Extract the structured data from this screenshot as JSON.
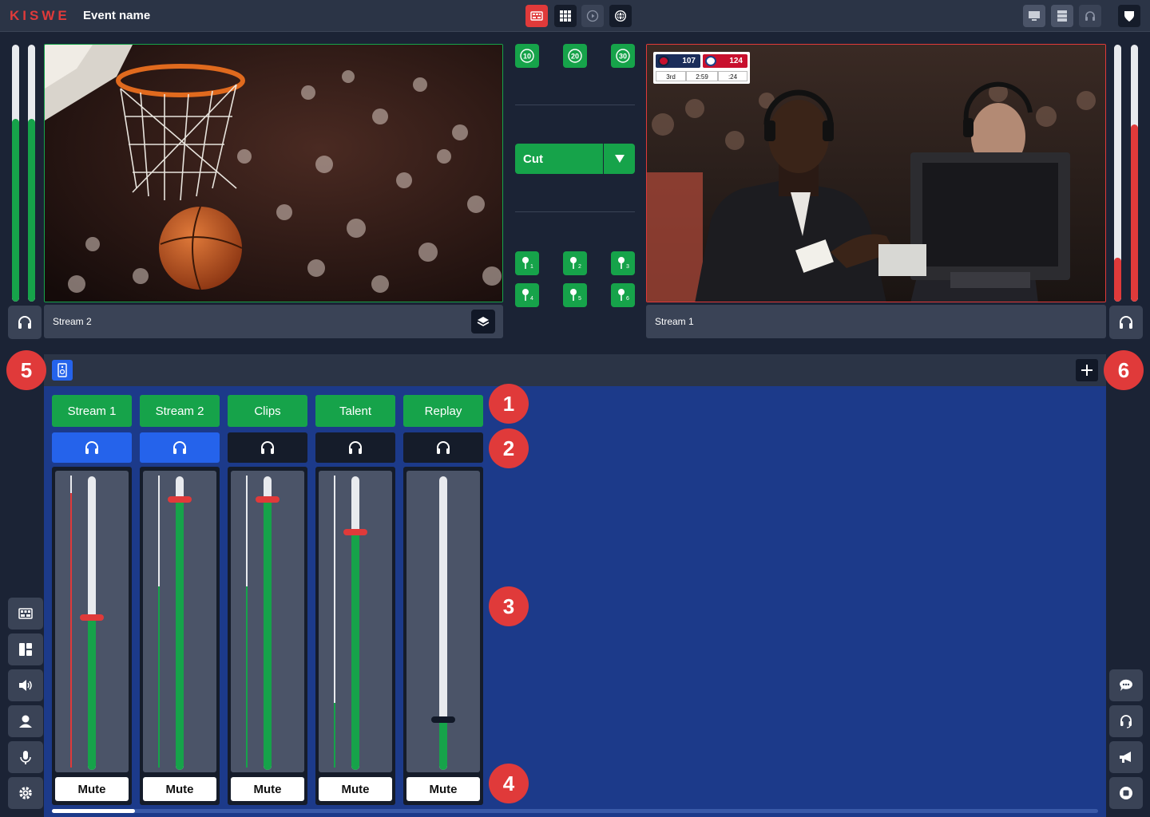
{
  "topbar": {
    "logo": "KISWE",
    "event_name": "Event name",
    "center_buttons": [
      "multiview-icon",
      "grid-icon",
      "replay-icon",
      "web-icon"
    ],
    "right_buttons": [
      "monitor-icon",
      "server-icon",
      "headset-icon",
      "shield-icon"
    ]
  },
  "preview": {
    "label": "Stream 2",
    "audio_levels": [
      0.71,
      0.71
    ]
  },
  "program": {
    "label": "Stream 1",
    "audio_levels": [
      0.17,
      0.69
    ]
  },
  "transport": {
    "skip_back": [
      "10",
      "20",
      "30"
    ],
    "cut_label": "Cut",
    "markers": [
      "1",
      "2",
      "3",
      "4",
      "5",
      "6"
    ]
  },
  "scoreboard": {
    "away_score": "107",
    "home_score": "124",
    "period": "3rd",
    "clock": "2:59",
    "shot_clock": ":24"
  },
  "mixer": {
    "channels": [
      {
        "label": "Stream 1",
        "listen": true,
        "fader": 0.52,
        "meter": 0.94,
        "meter_color": "#e03a3a",
        "mute_label": "Mute"
      },
      {
        "label": "Stream 2",
        "listen": true,
        "fader": 0.92,
        "meter": 0.62,
        "meter_color": "#16a34a",
        "mute_label": "Mute"
      },
      {
        "label": "Clips",
        "listen": false,
        "fader": 0.92,
        "meter": 0.62,
        "meter_color": "#16a34a",
        "mute_label": "Mute"
      },
      {
        "label": "Talent",
        "listen": false,
        "fader": 0.81,
        "meter": 0.22,
        "meter_color": "#16a34a",
        "mute_label": "Mute"
      },
      {
        "label": "Replay",
        "listen": false,
        "fader": 0.17,
        "meter": 0.0,
        "meter_color": "#16a34a",
        "mute_label": "Mute"
      }
    ]
  },
  "markers": [
    "1",
    "2",
    "3",
    "4",
    "5",
    "6"
  ],
  "colors": {
    "accent_green": "#16a34a",
    "accent_red": "#e03a3a",
    "accent_blue": "#2563eb",
    "mixer_bg": "#1c3a8a"
  }
}
